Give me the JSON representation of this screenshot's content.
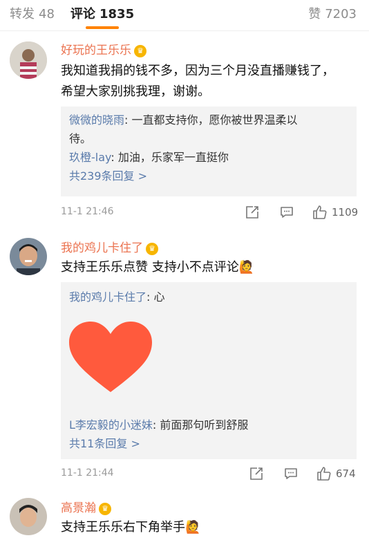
{
  "tabs": {
    "repost_label": "转发",
    "repost_count": "48",
    "comment_label": "评论",
    "comment_count": "1835",
    "like_label": "赞",
    "like_count": "7203"
  },
  "comments": [
    {
      "user": "好玩的王乐乐",
      "text_line1": "我知道我捐的钱不多，因为三个月没直播赚钱了，",
      "text_line2": "希望大家别挑我理，谢谢。",
      "replies": [
        {
          "name": "微微的晓雨",
          "sep": ": ",
          "text_line1": "一直都支持你，愿你被世界温柔以",
          "text_line2": "待。"
        },
        {
          "name": "玖橙-lay",
          "sep": ": ",
          "text": "加油，乐家军一直挺你"
        }
      ],
      "more_replies": "共239条回复 >",
      "time": "11-1 21:46",
      "likes": "1109"
    },
    {
      "user": "我的鸡儿卡住了",
      "text": "支持王乐乐点赞 支持小不点评论🙋",
      "replies": [
        {
          "name": "我的鸡儿卡住了",
          "sep": ": ",
          "text": "心"
        },
        {
          "name": "L李宏毅的小迷妹",
          "sep": ": ",
          "text": "前面那句听到舒服"
        }
      ],
      "more_replies": "共11条回复 >",
      "time": "11-1 21:44",
      "likes": "674"
    },
    {
      "user": "高景瀚",
      "text": "支持王乐乐右下角举手🙋"
    }
  ],
  "colors": {
    "accent": "#ff8200",
    "username": "#eb7350",
    "reply_name": "#5a7bab",
    "heart": "#ff5a3d"
  },
  "icons": [
    "crown-icon",
    "share-icon",
    "comment-icon",
    "like-icon",
    "heart-icon"
  ]
}
